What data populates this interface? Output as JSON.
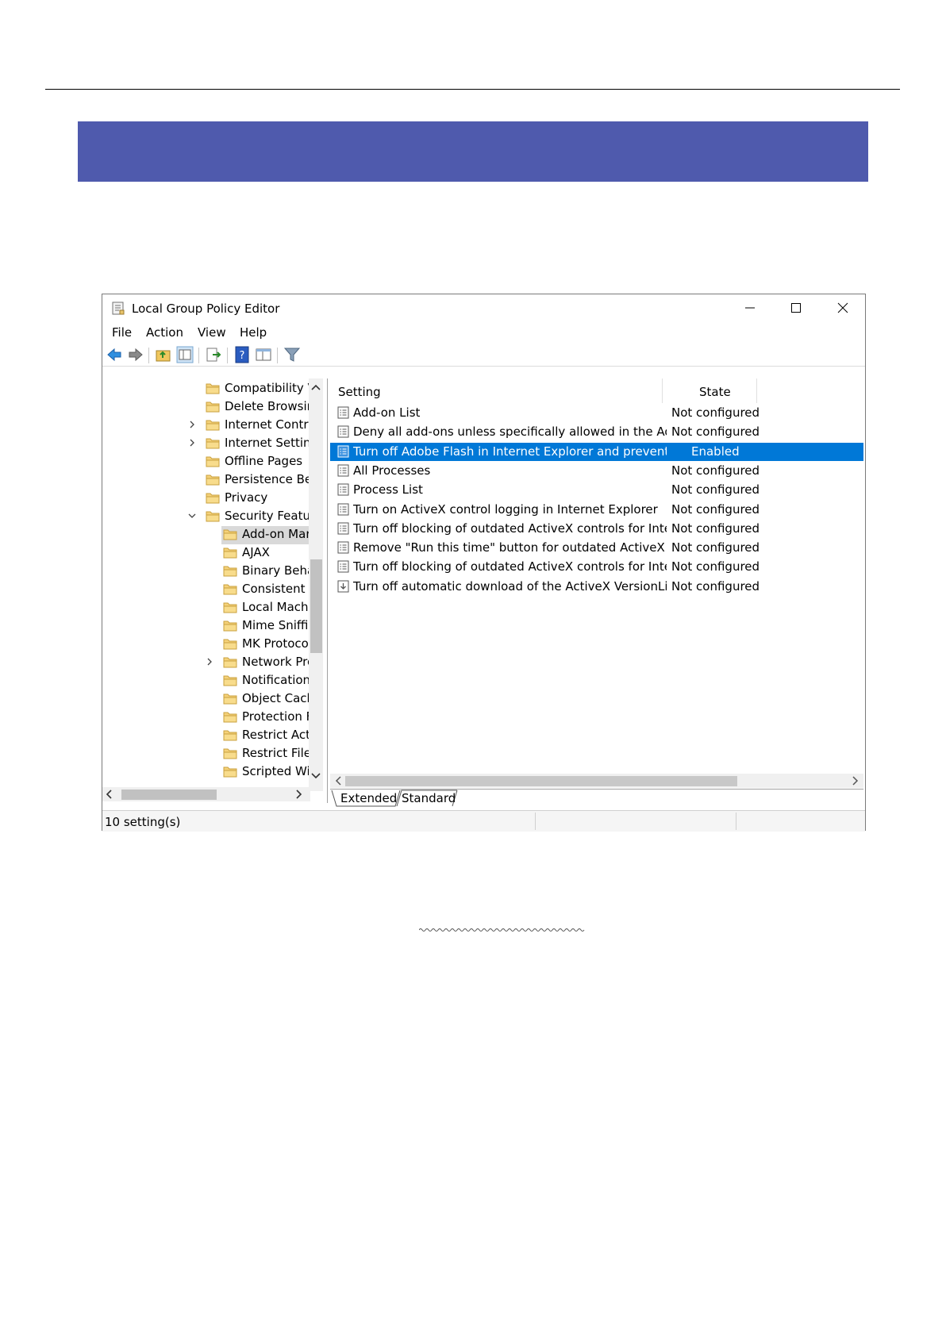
{
  "window": {
    "title": "Local Group Policy Editor",
    "minimize_glyph": "—",
    "maximize_glyph": "☐",
    "close_glyph": "✕"
  },
  "menu": [
    "File",
    "Action",
    "View",
    "Help"
  ],
  "toolbar": {
    "icons": [
      "back-arrow-icon",
      "forward-arrow-icon",
      "up-folder-icon",
      "show-hide-tree-icon",
      "export-list-icon",
      "help-icon",
      "properties-view-icon",
      "filter-icon"
    ]
  },
  "tree": {
    "items": [
      {
        "label": "Compatibility V",
        "indent": 1,
        "expander": "",
        "selected": false
      },
      {
        "label": "Delete Browsing",
        "indent": 1,
        "expander": "",
        "selected": false
      },
      {
        "label": "Internet Contro",
        "indent": 1,
        "expander": "collapsed",
        "selected": false
      },
      {
        "label": "Internet Setting",
        "indent": 1,
        "expander": "collapsed",
        "selected": false
      },
      {
        "label": "Offline Pages",
        "indent": 1,
        "expander": "",
        "selected": false
      },
      {
        "label": "Persistence Beh",
        "indent": 1,
        "expander": "",
        "selected": false
      },
      {
        "label": "Privacy",
        "indent": 1,
        "expander": "",
        "selected": false
      },
      {
        "label": "Security Feature",
        "indent": 1,
        "expander": "expanded",
        "selected": false
      },
      {
        "label": "Add-on Mar",
        "indent": 2,
        "expander": "",
        "selected": true
      },
      {
        "label": "AJAX",
        "indent": 2,
        "expander": "",
        "selected": false
      },
      {
        "label": "Binary Beha",
        "indent": 2,
        "expander": "",
        "selected": false
      },
      {
        "label": "Consistent N",
        "indent": 2,
        "expander": "",
        "selected": false
      },
      {
        "label": "Local Machi",
        "indent": 2,
        "expander": "",
        "selected": false
      },
      {
        "label": "Mime Sniffi",
        "indent": 2,
        "expander": "",
        "selected": false
      },
      {
        "label": "MK Protoco",
        "indent": 2,
        "expander": "",
        "selected": false
      },
      {
        "label": "Network Prc",
        "indent": 2,
        "expander": "collapsed",
        "selected": false
      },
      {
        "label": "Notification",
        "indent": 2,
        "expander": "",
        "selected": false
      },
      {
        "label": "Object Cach",
        "indent": 2,
        "expander": "",
        "selected": false
      },
      {
        "label": "Protection F",
        "indent": 2,
        "expander": "",
        "selected": false
      },
      {
        "label": "Restrict Acti",
        "indent": 2,
        "expander": "",
        "selected": false
      },
      {
        "label": "Restrict File",
        "indent": 2,
        "expander": "",
        "selected": false
      },
      {
        "label": "Scripted Wir",
        "indent": 2,
        "expander": "",
        "selected": false
      }
    ]
  },
  "list": {
    "columns": {
      "setting": "Setting",
      "state": "State"
    },
    "rows": [
      {
        "name": "Add-on List",
        "state": "Not configured",
        "selected": false,
        "icon": "policy-icon"
      },
      {
        "name": "Deny all add-ons unless specifically allowed in the Add-on L...",
        "state": "Not configured",
        "selected": false,
        "icon": "policy-icon"
      },
      {
        "name": "Turn off Adobe Flash in Internet Explorer and prevent applic...",
        "state": "Enabled",
        "selected": true,
        "icon": "policy-icon"
      },
      {
        "name": "All Processes",
        "state": "Not configured",
        "selected": false,
        "icon": "policy-icon"
      },
      {
        "name": "Process List",
        "state": "Not configured",
        "selected": false,
        "icon": "policy-icon"
      },
      {
        "name": "Turn on ActiveX control logging in Internet Explorer",
        "state": "Not configured",
        "selected": false,
        "icon": "policy-icon"
      },
      {
        "name": "Turn off blocking of outdated ActiveX controls for Internet E...",
        "state": "Not configured",
        "selected": false,
        "icon": "policy-icon"
      },
      {
        "name": "Remove \"Run this time\" button for outdated ActiveX contro...",
        "state": "Not configured",
        "selected": false,
        "icon": "policy-icon"
      },
      {
        "name": "Turn off blocking of outdated ActiveX controls for Internet E...",
        "state": "Not configured",
        "selected": false,
        "icon": "policy-icon"
      },
      {
        "name": "Turn off automatic download of the ActiveX VersionList",
        "state": "Not configured",
        "selected": false,
        "icon": "policy-download-icon"
      }
    ]
  },
  "tabs": {
    "extended": "Extended",
    "standard": "Standard"
  },
  "status": {
    "text": "10 setting(s)"
  },
  "colors": {
    "banner": "#4f5aad",
    "selection": "#0078d7",
    "tree_selection": "#d9d9d9"
  }
}
